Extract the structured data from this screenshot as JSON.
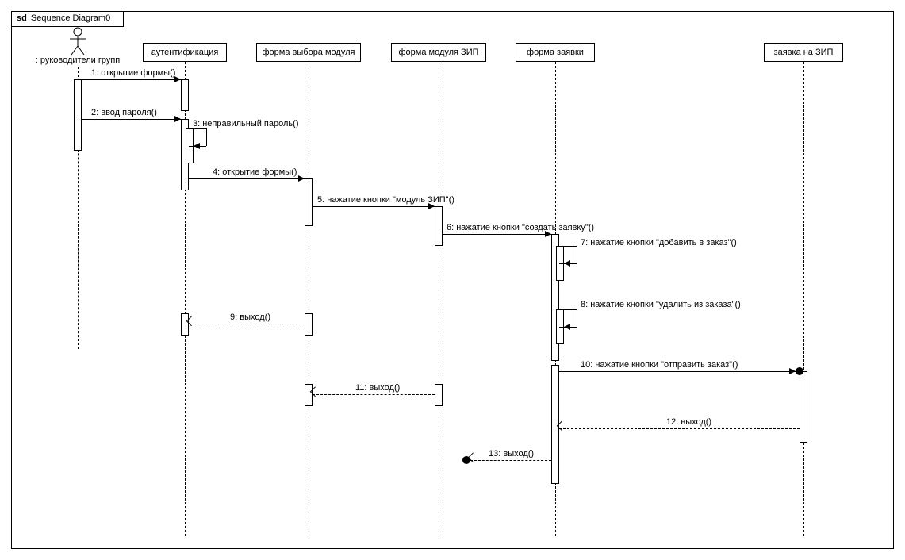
{
  "title_prefix": "sd",
  "title": "Sequence Diagram0",
  "actor": {
    "label": ": руководители групп"
  },
  "lifelines": {
    "l1": "аутентификация",
    "l2": "форма выбора модуля",
    "l3": "форма модуля ЗИП",
    "l4": "форма заявки",
    "l5": "заявка на ЗИП"
  },
  "messages": {
    "m1": "1: открытие формы()",
    "m2": "2: ввод пароля()",
    "m3": "3: неправильный пароль()",
    "m4": "4: открытие формы()",
    "m5": "5: нажатие кнопки \"модуль ЗИП\"()",
    "m6": "6: нажатие кнопки \"создать заявку\"()",
    "m7": "7: нажатие кнопки \"добавить в заказ\"()",
    "m8": "8: нажатие кнопки \"удалить из заказа\"()",
    "m9": "9: выход()",
    "m10": "10: нажатие кнопки \"отправить заказ\"()",
    "m11": "11: выход()",
    "m12": "12: выход()",
    "m13": "13: выход()"
  }
}
